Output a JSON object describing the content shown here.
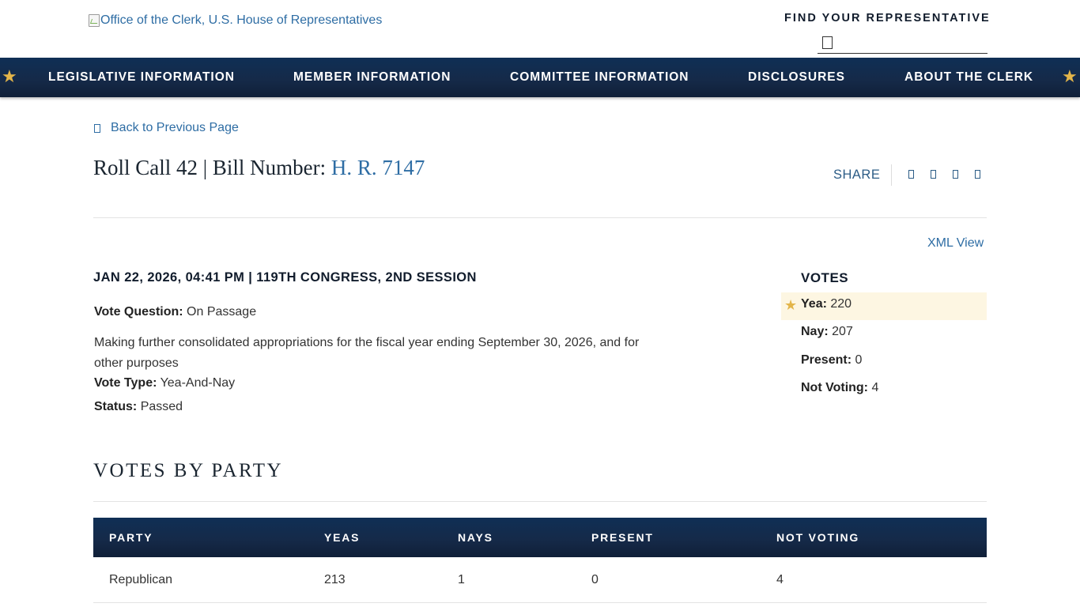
{
  "header": {
    "logo_alt": "Office of the Clerk, U.S. House of Representatives",
    "find_rep_label": "FIND YOUR REPRESENTATIVE",
    "search_icon": "search-icon"
  },
  "nav": {
    "items": [
      "LEGISLATIVE INFORMATION",
      "MEMBER INFORMATION",
      "COMMITTEE INFORMATION",
      "DISCLOSURES",
      "ABOUT THE CLERK"
    ],
    "star_glyph": "★",
    "star_color": "#e3b54a",
    "background_color": "#152a49"
  },
  "back_link": "Back to Previous Page",
  "title": {
    "prefix": "Roll Call 42 | Bill Number: ",
    "bill": "H. R. 7147"
  },
  "share": {
    "label": "SHARE",
    "icons": [
      "facebook-icon",
      "twitter-icon",
      "email-icon",
      "print-icon"
    ]
  },
  "xml_view": "XML View",
  "vote_meta": "JAN 22, 2026, 04:41 PM | 119TH CONGRESS, 2ND SESSION",
  "details": {
    "question_label": "Vote Question:",
    "question_value": "On Passage",
    "description": "Making further consolidated appropriations for the fiscal year ending September 30, 2026, and for other purposes",
    "type_label": "Vote Type:",
    "type_value": "Yea-And-Nay",
    "status_label": "Status:",
    "status_value": "Passed"
  },
  "votes": {
    "heading": "VOTES",
    "rows": [
      {
        "label": "Yea:",
        "value": "220",
        "winner": true
      },
      {
        "label": "Nay:",
        "value": "207",
        "winner": false
      },
      {
        "label": "Present:",
        "value": "0",
        "winner": false
      },
      {
        "label": "Not Voting:",
        "value": "4",
        "winner": false
      }
    ],
    "winner_highlight_color": "#fdf6e2"
  },
  "votes_by_party": {
    "heading": "VOTES BY PARTY",
    "columns": [
      "PARTY",
      "YEAS",
      "NAYS",
      "PRESENT",
      "NOT VOTING"
    ],
    "rows": [
      [
        "Republican",
        "213",
        "1",
        "0",
        "4"
      ]
    ]
  },
  "colors": {
    "link": "#2e6da4",
    "navy": "#111c2c"
  }
}
